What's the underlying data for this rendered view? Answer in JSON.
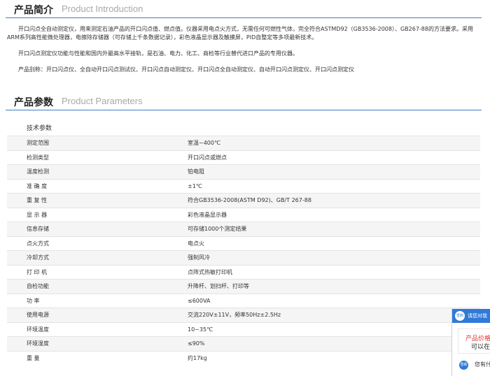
{
  "intro": {
    "title_cn": "产品简介",
    "title_en": "Product Introduction",
    "paragraphs": [
      "开口闪点全自动测定仪，用来测定石油产品的开口闪点值、燃点值。仪器采用电点火方式，无需任何可燃性气体，完全符合ASTMD92（GB3536-2008）、GB267-88的方法要求。采用ARM系列高性能微处理器，电擦除存储器（可存储上千条数据记录），彩色液晶显示器及触摸屏，PID自整定等多项最新技术。",
      "开口闪点测定仪功能与性能和国内外最高水平接轨，是石油、电力、化工、商检等行业替代进口产品的专用仪器。",
      "产品别称：开口闪点仪、全自动开口闪点测试仪、开口闪点自动测定仪、开口闪点全自动测定仪、自动开口闪点测定仪、开口闪点测定仪"
    ]
  },
  "params": {
    "title_cn": "产品参数",
    "title_en": "Product Parameters",
    "subtitle": "技术参数",
    "rows": [
      {
        "key": "测定范围",
        "value": "室温~400℃"
      },
      {
        "key": "检测类型",
        "value": "开口闪点或燃点"
      },
      {
        "key": "温度检测",
        "value": "铂电阻"
      },
      {
        "key": "准 确 度",
        "value": "±1℃"
      },
      {
        "key": "重 复 性",
        "value": "符合GB3536-2008(ASTM D92)、GB/T 267-88"
      },
      {
        "key": "显 示 器",
        "value": "彩色液晶显示器"
      },
      {
        "key": "信息存储",
        "value": "可存储1000个测定结果"
      },
      {
        "key": "点火方式",
        "value": "电点火"
      },
      {
        "key": "冷却方式",
        "value": "强制风冷"
      },
      {
        "key": "打 印 机",
        "value": "点阵式热敏打印机"
      },
      {
        "key": "自检功能",
        "value": "升降杆、划扫杆、打印等"
      },
      {
        "key": "功  率",
        "value": "≤600VA"
      },
      {
        "key": "使用电源",
        "value": "交流220V±11V，频率50Hz±2.5Hz"
      },
      {
        "key": "环境温度",
        "value": "10~35℃"
      },
      {
        "key": "环境湿度",
        "value": "≤90%"
      },
      {
        "key": "重  量",
        "value": "约17kg"
      }
    ]
  },
  "chat_widget": {
    "avatar_text": "雪莉",
    "header": "请您对我",
    "card_line1": "产品价格",
    "card_line2": "可以在",
    "message": "您有什"
  },
  "colors": {
    "accent_line": "#3a7fc4",
    "chat_blue": "#2f7ad8",
    "price_red": "#e0312b"
  }
}
